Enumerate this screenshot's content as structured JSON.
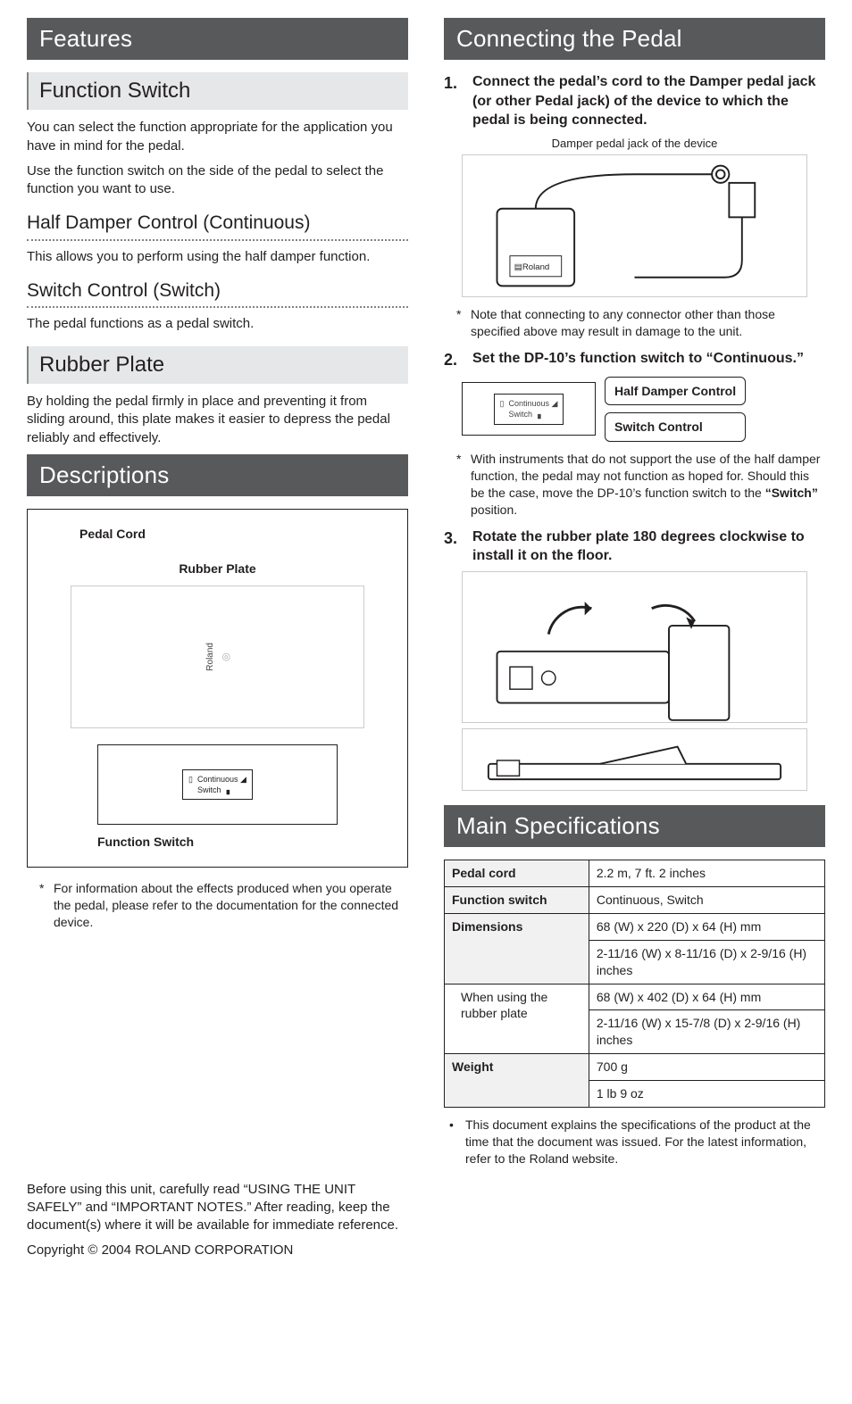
{
  "left": {
    "features_title": "Features",
    "function_switch_title": "Function Switch",
    "function_switch_p1": "You can select the function appropriate for the application you have in mind for the pedal.",
    "function_switch_p2": "Use the function switch on the side of the pedal to select the function you want to use.",
    "half_damper_title": "Half Damper Control (Continuous)",
    "half_damper_p": "This allows you to perform using the half damper function.",
    "switch_control_title": "Switch Control (Switch)",
    "switch_control_p": "The pedal functions as a pedal switch.",
    "rubber_plate_title": "Rubber Plate",
    "rubber_plate_p": "By holding the pedal firmly in place and preventing it from sliding around, this plate makes it easier to depress the pedal reliably and effectively.",
    "descriptions_title": "Descriptions",
    "diagram_labels": {
      "pedal_cord": "Pedal Cord",
      "rubber_plate": "Rubber Plate",
      "function_switch": "Function Switch",
      "continuous": "Continuous",
      "switch": "Switch"
    },
    "desc_note": "For information about the effects produced when you operate the pedal, please refer to the documentation for the connected device.",
    "safety": "Before using this unit, carefully read “USING THE UNIT SAFELY” and “IMPORTANT NOTES.” After reading, keep the document(s) where it will be available for immediate reference.",
    "copyright": "Copyright © 2004 ROLAND CORPORATION"
  },
  "right": {
    "connecting_title": "Connecting the Pedal",
    "step1": "Connect the pedal’s cord to the Damper pedal jack (or other Pedal jack) of the device to which the pedal is being connected.",
    "caption1": "Damper pedal jack of the device",
    "brand": "Roland",
    "note1": "Note that connecting to any connector other than those specified above may result in damage to the unit.",
    "step2": "Set the DP-10’s function switch to “Continuous.”",
    "callout_half": "Half Damper Control",
    "callout_switch": "Switch Control",
    "switch_labels": {
      "continuous": "Continuous",
      "switch": "Switch"
    },
    "note2_a": "With instruments that do not support the use of the half damper function, the pedal may not function as hoped for. Should this be the case, move the DP-10’s function switch to the ",
    "note2_b": "“Switch”",
    "note2_c": " position.",
    "step3": "Rotate the rubber plate 180 degrees clockwise to install it on the floor.",
    "specs_title": "Main Specifications",
    "specs": {
      "pedal_cord_h": "Pedal cord",
      "pedal_cord_v": "2.2 m, 7 ft. 2 inches",
      "func_switch_h": "Function switch",
      "func_switch_v": "Continuous, Switch",
      "dim_h": "Dimensions",
      "dim_v1": "68 (W) x 220 (D) x 64 (H) mm",
      "dim_v2": "2-11/16 (W) x 8-11/16 (D) x 2-9/16 (H) inches",
      "dim_rubber_h": "When using the rubber plate",
      "dim_rubber_v1": "68 (W) x 402 (D) x 64 (H) mm",
      "dim_rubber_v2": "2-11/16 (W) x 15-7/8 (D) x 2-9/16 (H) inches",
      "weight_h": "Weight",
      "weight_v1": "700 g",
      "weight_v2": "1 lb 9 oz"
    },
    "spec_note": "This document explains the specifications of the product at the time that the document was issued. For the latest information, refer to the Roland website."
  }
}
